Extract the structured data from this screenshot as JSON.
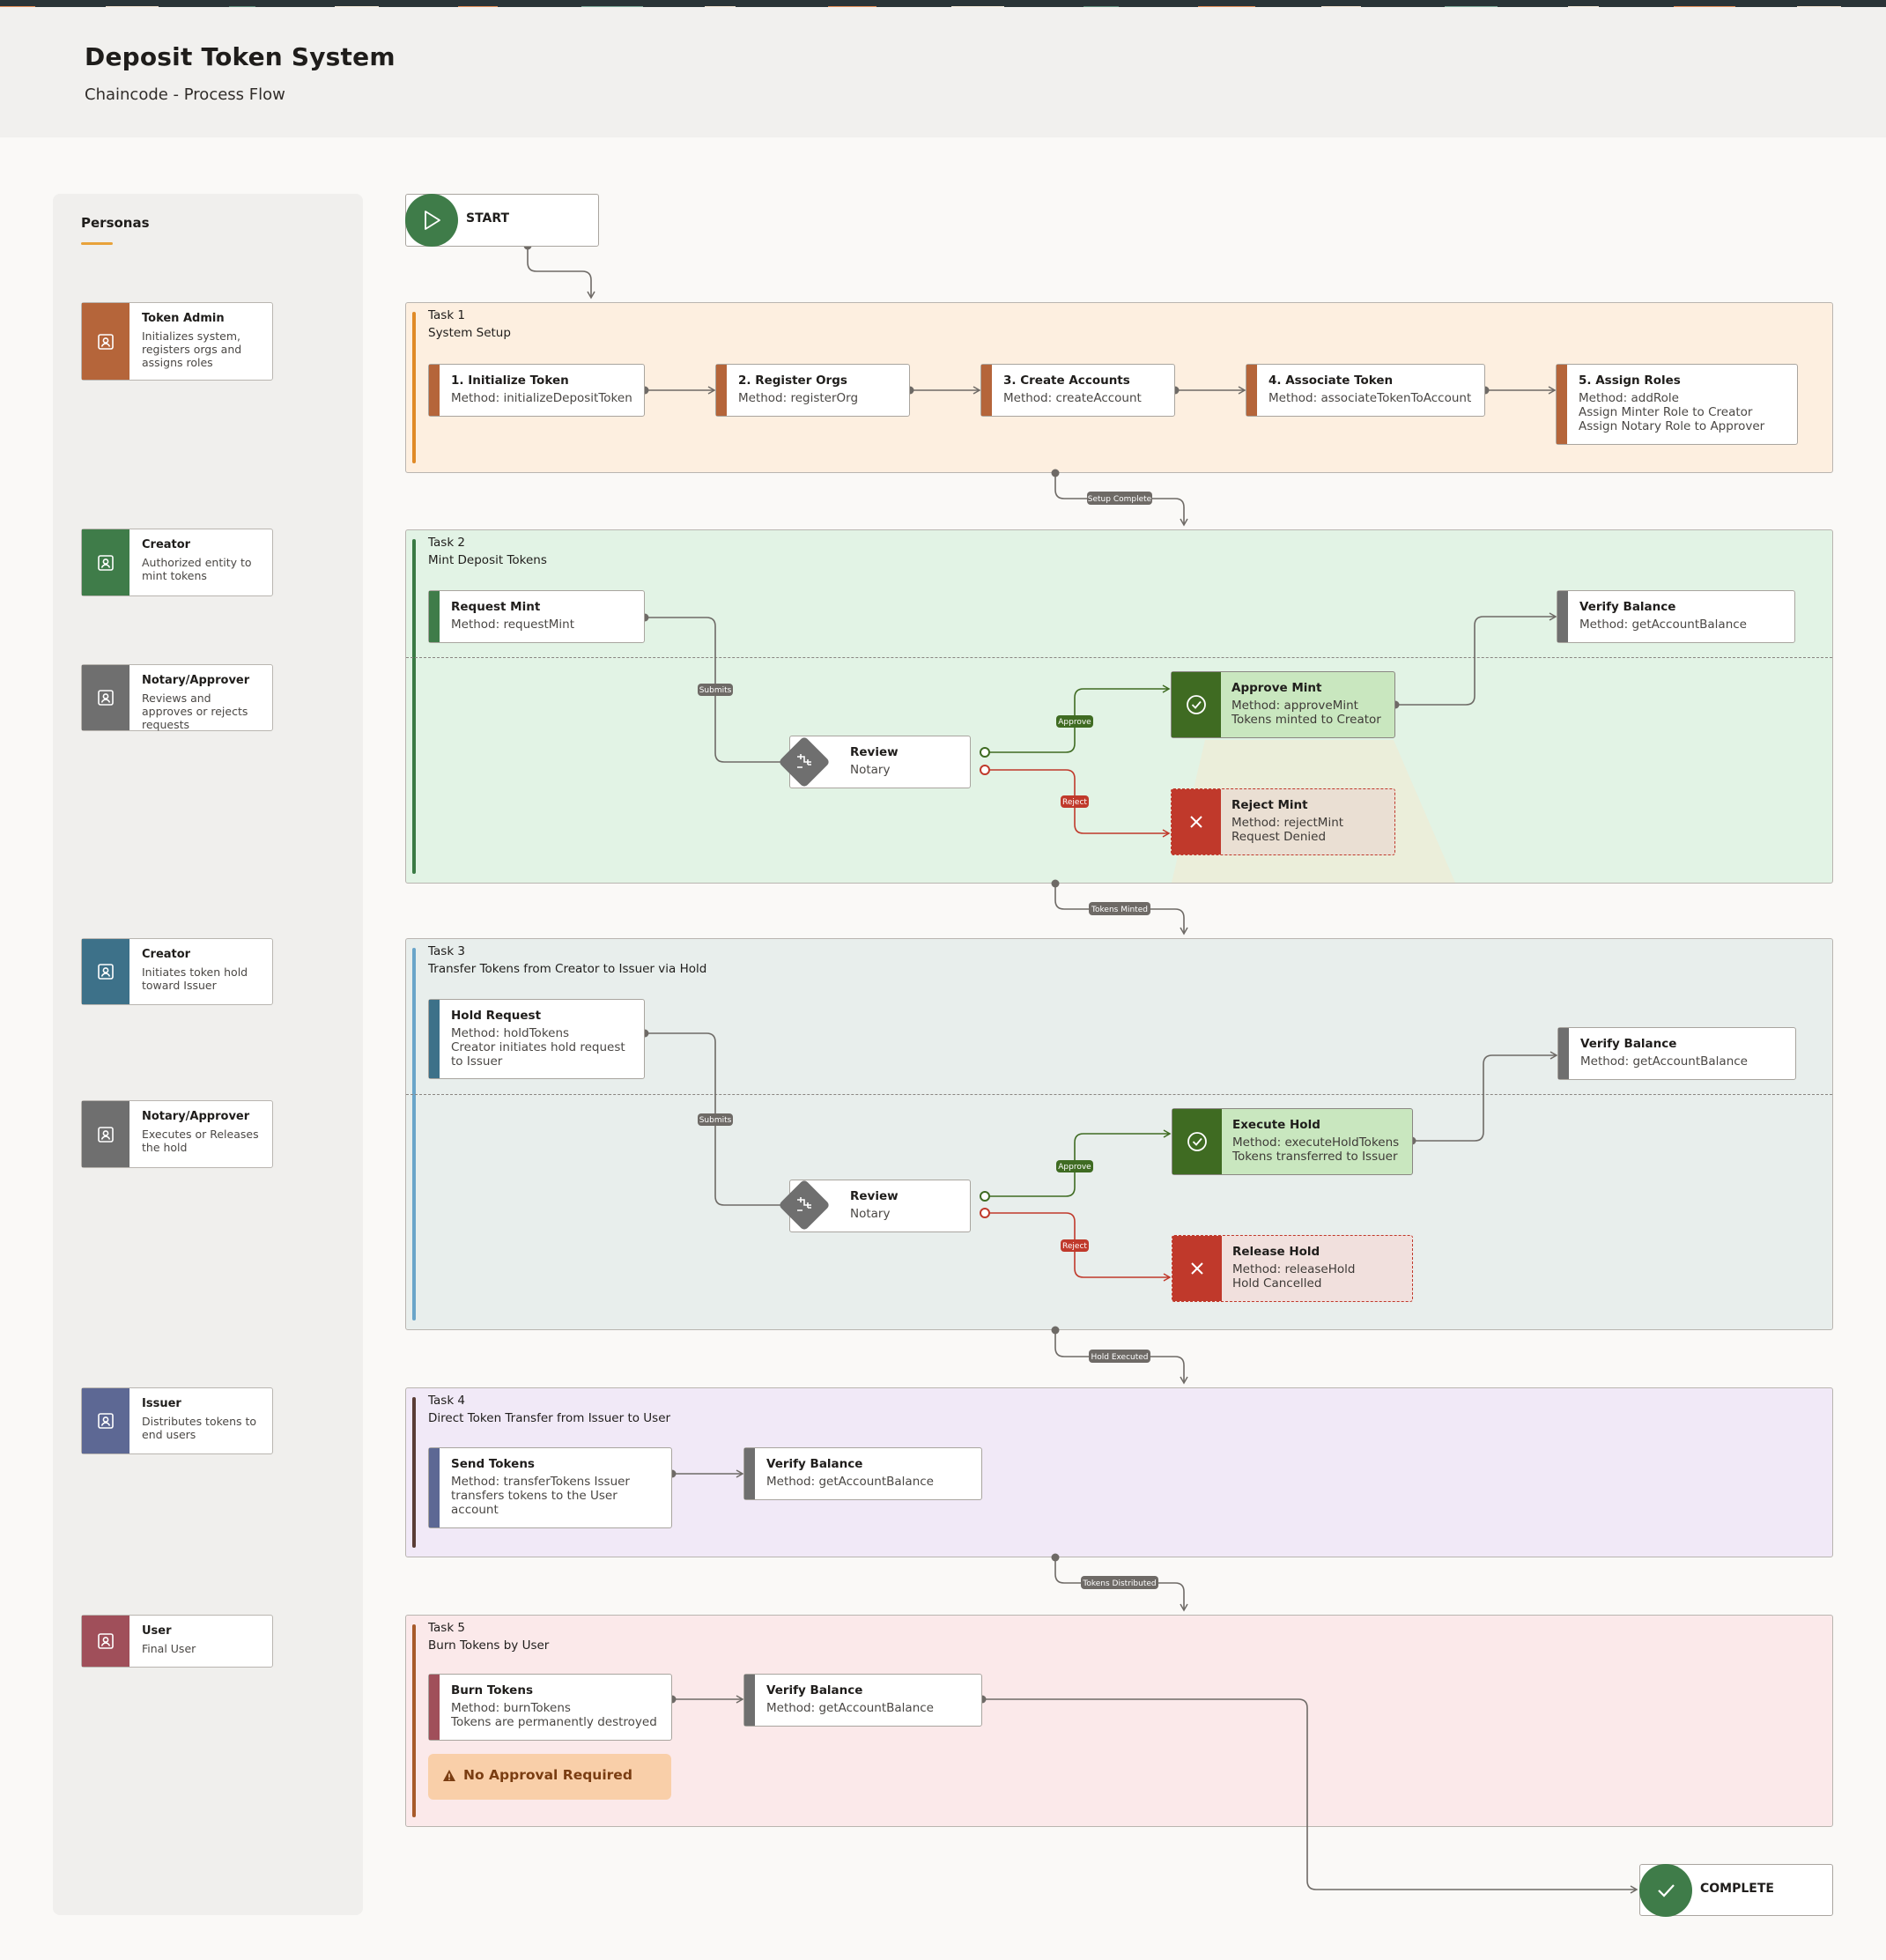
{
  "header": {
    "title": "Deposit Token System",
    "subtitle": "Chaincode - Process Flow"
  },
  "personas": {
    "heading": "Personas",
    "items": [
      {
        "name": "Token Admin",
        "description": "Initializes system, registers orgs and assigns roles",
        "color": "#b5653a"
      },
      {
        "name": "Creator",
        "description": "Authorized entity to mint tokens",
        "color": "#3f7c49"
      },
      {
        "name": "Notary/Approver",
        "description": "Reviews and approves or rejects requests",
        "color": "#6f6f6f"
      },
      {
        "name": "Creator",
        "description": "Initiates token hold toward Issuer",
        "color": "#3d7189"
      },
      {
        "name": "Notary/Approver",
        "description": "Executes or Releases the hold",
        "color": "#6f6f6f"
      },
      {
        "name": "Issuer",
        "description": "Distributes tokens to end users",
        "color": "#5d6894"
      },
      {
        "name": "User",
        "description": "Final User",
        "color": "#a04f5a"
      }
    ]
  },
  "start": {
    "label": "START"
  },
  "complete": {
    "label": "COMPLETE"
  },
  "tasks": [
    {
      "number": "Task 1",
      "name": "System Setup",
      "steps": [
        {
          "title": "1. Initialize Token",
          "desc": "Method: initializeDepositToken"
        },
        {
          "title": "2. Register Orgs",
          "desc": "Method: registerOrg"
        },
        {
          "title": "3. Create Accounts",
          "desc": "Method: createAccount"
        },
        {
          "title": "4. Associate Token",
          "desc": "Method: associateTokenToAccount"
        },
        {
          "title": "5. Assign Roles",
          "desc": "Method: addRole\nAssign Minter Role to Creator\nAssign Notary Role to Approver"
        }
      ]
    },
    {
      "number": "Task 2",
      "name": "Mint Deposit Tokens",
      "request": {
        "title": "Request Mint",
        "desc": "Method: requestMint"
      },
      "review": {
        "title": "Review",
        "desc": "Notary"
      },
      "approve": {
        "title": "Approve Mint",
        "desc": "Method: approveMint\nTokens minted to Creator"
      },
      "reject": {
        "title": "Reject Mint",
        "desc": "Method: rejectMint\nRequest Denied"
      },
      "verify": {
        "title": "Verify Balance",
        "desc": "Method: getAccountBalance"
      }
    },
    {
      "number": "Task 3",
      "name": "Transfer Tokens from Creator to Issuer via Hold",
      "request": {
        "title": "Hold Request",
        "desc": "Method: holdTokens\nCreator initiates hold request to Issuer"
      },
      "review": {
        "title": "Review",
        "desc": "Notary"
      },
      "approve": {
        "title": "Execute Hold",
        "desc": "Method: executeHoldTokens\nTokens transferred to Issuer"
      },
      "reject": {
        "title": "Release Hold",
        "desc": "Method: releaseHold\nHold Cancelled"
      },
      "verify": {
        "title": "Verify Balance",
        "desc": "Method: getAccountBalance"
      }
    },
    {
      "number": "Task 4",
      "name": "Direct Token Transfer from Issuer to User",
      "steps": [
        {
          "title": "Send Tokens",
          "desc": "Method: transferTokens\nIssuer transfers tokens to the User account"
        },
        {
          "title": "Verify Balance",
          "desc": "Method: getAccountBalance"
        }
      ]
    },
    {
      "number": "Task 5",
      "name": "Burn Tokens by User",
      "steps": [
        {
          "title": "Burn Tokens",
          "desc": "Method: burnTokens\nTokens are permanently destroyed"
        },
        {
          "title": "Verify Balance",
          "desc": "Method: getAccountBalance"
        }
      ],
      "notice": "No Approval Required"
    }
  ],
  "connectors": {
    "setup_complete": "Setup Complete",
    "tokens_minted": "Tokens Minted",
    "hold_executed": "Hold Executed",
    "tokens_distributed": "Tokens Distributed",
    "submits": "Submits",
    "approve": "Approve",
    "reject": "Reject"
  },
  "colors": {
    "task1_bg": "#fdefe0",
    "task2_bg": "#e2f3e5",
    "task3_bg": "#e8eeec",
    "task4_bg": "#f1e9f7",
    "task5_bg": "#fbe9ea",
    "approve_green": "#3f6b22",
    "reject_red": "#c0392b",
    "connector_gray": "#6e6a66"
  }
}
